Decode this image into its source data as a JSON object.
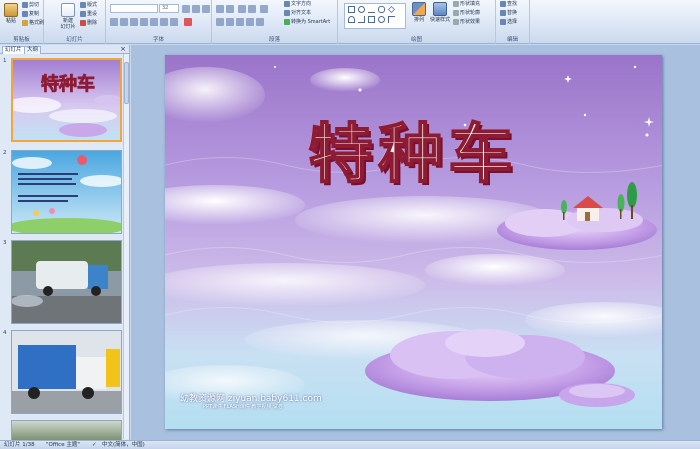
{
  "ribbon": {
    "clipboard": {
      "paste": "粘贴",
      "cut": "剪切",
      "copy": "复制",
      "format_painter": "格式刷",
      "title": "剪贴板"
    },
    "slides": {
      "new_slide": "新建\n幻灯片",
      "layout": "版式",
      "reset": "重设",
      "delete": "删除",
      "title": "幻灯片"
    },
    "font": {
      "font_value": "",
      "size_value": "32",
      "title": "字体"
    },
    "paragraph": {
      "text_direction": "文字方向",
      "align_text": "对齐文本",
      "convert_smartart": "转换为 SmartArt",
      "title": "段落"
    },
    "drawing": {
      "arrange": "排列",
      "quick_styles": "快速样式",
      "shape_fill": "形状填充",
      "shape_outline": "形状轮廓",
      "shape_effects": "形状效果",
      "title": "绘图"
    },
    "editing": {
      "find": "查找",
      "replace": "替换",
      "select": "选择",
      "title": "编辑"
    }
  },
  "panel": {
    "tabs": [
      "幻灯片",
      "大纲"
    ],
    "close": "×",
    "slides": [
      {
        "num": "1",
        "selected": true,
        "label": "特种车"
      },
      {
        "num": "2",
        "selected": false,
        "label": ""
      },
      {
        "num": "3",
        "selected": false,
        "label": ""
      },
      {
        "num": "4",
        "selected": false,
        "label": ""
      }
    ]
  },
  "slide": {
    "title": "特种车",
    "site": "幼教资源网 ziyuan.baby611.com",
    "sub": "PPT课件   FLASH课件   教学视频   试卷"
  },
  "status": {
    "slide_count": "幻灯片 1/38",
    "theme": "\"Office 主题\"",
    "language": "中文(简体，中国)"
  }
}
